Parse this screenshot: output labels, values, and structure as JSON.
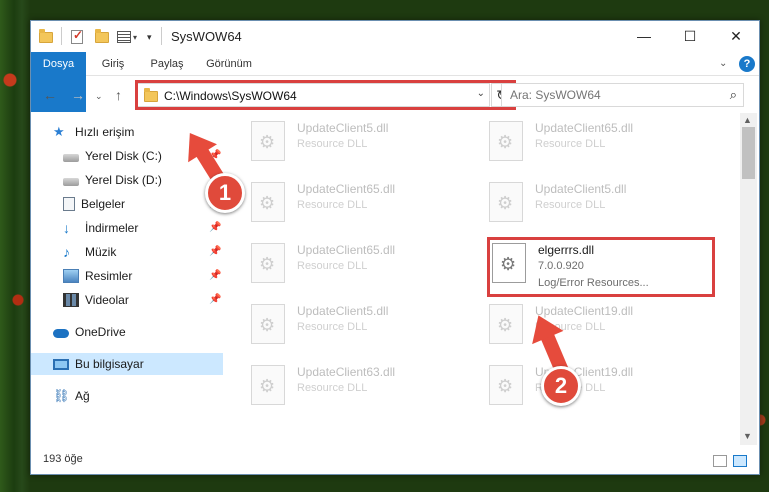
{
  "window": {
    "title": "SysWOW64",
    "controls": {
      "minimize": "—",
      "maximize": "☐",
      "close": "✕"
    }
  },
  "ribbon": {
    "tabs": [
      "Dosya",
      "Giriş",
      "Paylaş",
      "Görünüm"
    ],
    "help": "?"
  },
  "address": {
    "path": "C:\\Windows\\SysWOW64",
    "search_placeholder": "Ara: SysWOW64"
  },
  "sidebar": {
    "items": [
      {
        "label": "Hızlı erişim",
        "icon": "star-icon",
        "pinned": false
      },
      {
        "label": "Yerel Disk (C:)",
        "icon": "drive-icon",
        "pinned": true
      },
      {
        "label": "Yerel Disk (D:)",
        "icon": "drive-icon",
        "pinned": true
      },
      {
        "label": "Belgeler",
        "icon": "documents-icon",
        "pinned": true
      },
      {
        "label": "İndirmeler",
        "icon": "downloads-icon",
        "pinned": true
      },
      {
        "label": "Müzik",
        "icon": "music-icon",
        "pinned": true
      },
      {
        "label": "Resimler",
        "icon": "pictures-icon",
        "pinned": true
      },
      {
        "label": "Videolar",
        "icon": "videos-icon",
        "pinned": true
      },
      {
        "label": "OneDrive",
        "icon": "onedrive-icon",
        "pinned": false
      },
      {
        "label": "Bu bilgisayar",
        "icon": "this-pc-icon",
        "pinned": false,
        "selected": true
      },
      {
        "label": "Ağ",
        "icon": "network-icon",
        "pinned": false
      }
    ]
  },
  "files": [
    {
      "name": "UpdateClient5.dll",
      "desc": "Resource DLL"
    },
    {
      "name": "UpdateClient65.dll",
      "desc": "Resource DLL"
    },
    {
      "name": "UpdateClient65.dll",
      "desc": "Resource DLL"
    },
    {
      "name": "UpdateClient5.dll",
      "desc": "Resource DLL"
    },
    {
      "name": "UpdateClient65.dll",
      "desc": "Resource DLL"
    },
    {
      "name": "elgerrrs.dll",
      "desc": "7.0.0.920",
      "desc2": "Log/Error Resources...",
      "active": true
    },
    {
      "name": "UpdateClient5.dll",
      "desc": "Resource DLL"
    },
    {
      "name": "UpdateClient19.dll",
      "desc": "Resource DLL"
    },
    {
      "name": "UpdateClient63.dll",
      "desc": "Resource DLL"
    },
    {
      "name": "UpdateClient19.dll",
      "desc": "Resource DLL"
    }
  ],
  "status": {
    "count": "193 öğe"
  },
  "callouts": {
    "step1": "1",
    "step2": "2"
  },
  "colors": {
    "highlight": "#d9403f",
    "accent": "#1979ca",
    "callout": "#e04a3b"
  }
}
